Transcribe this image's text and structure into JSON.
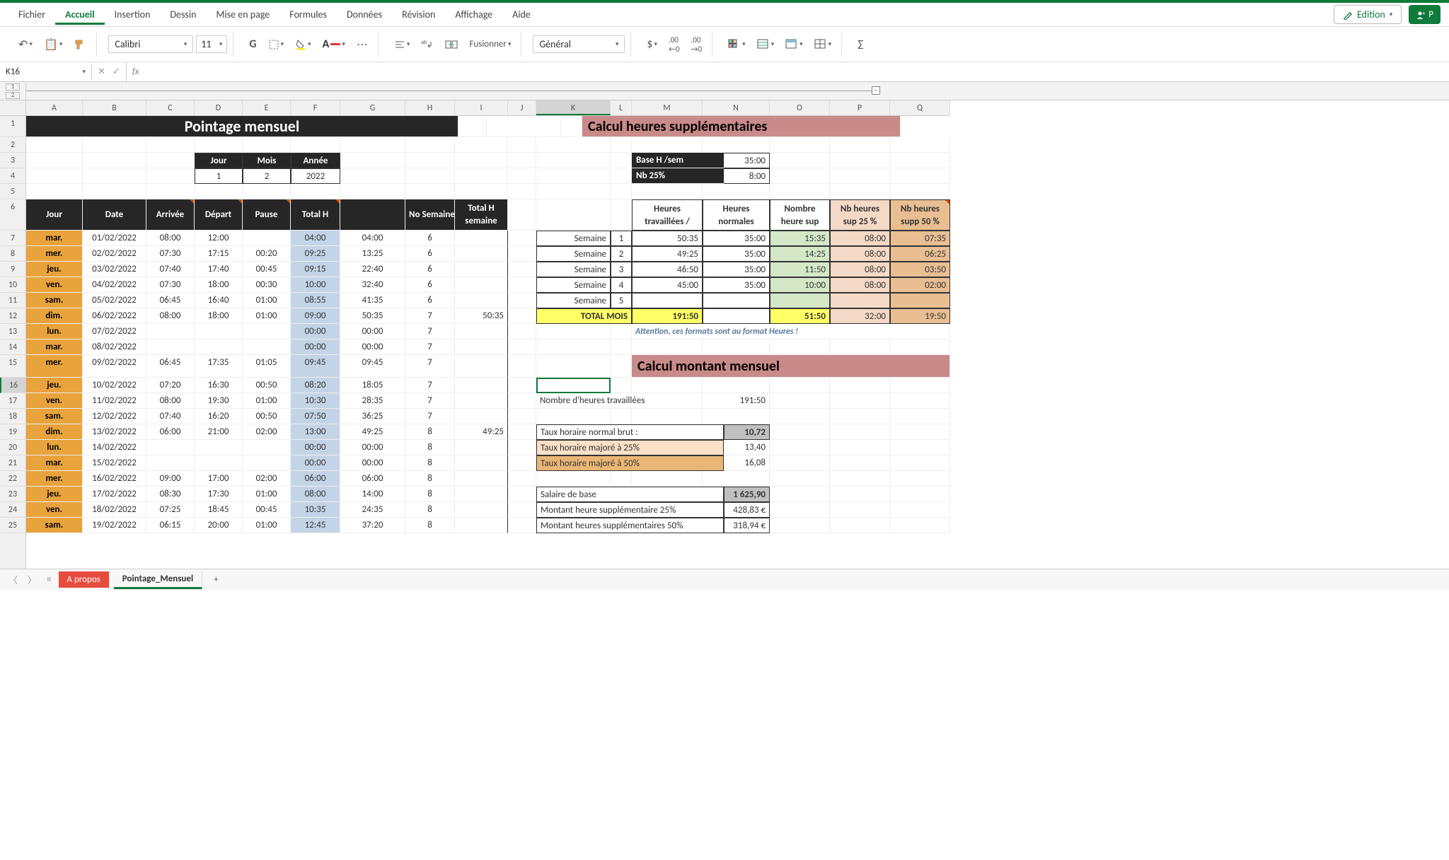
{
  "menu": {
    "items": [
      "Fichier",
      "Accueil",
      "Insertion",
      "Dessin",
      "Mise en page",
      "Formules",
      "Données",
      "Révision",
      "Affichage",
      "Aide"
    ],
    "active": 1,
    "edition": "Edition",
    "share": "P"
  },
  "ribbon": {
    "font": "Calibri",
    "size": "11",
    "format": "Général",
    "merge": "Fusionner"
  },
  "namebox": "K16",
  "cols": [
    "A",
    "B",
    "C",
    "D",
    "E",
    "F",
    "G",
    "H",
    "I",
    "J",
    "K",
    "L",
    "M",
    "N",
    "O",
    "P",
    "Q"
  ],
  "title": "Pointage mensuel",
  "dateHdr": {
    "j": "Jour",
    "m": "Mois",
    "a": "Année",
    "jv": "1",
    "mv": "2",
    "av": "2022"
  },
  "mainHdr": {
    "jour": "Jour",
    "date": "Date",
    "arr": "Arrivée",
    "dep": "Départ",
    "pause": "Pause",
    "tot": "Total H",
    "sem": "No Semaine",
    "totsem": "Total H\nsemaine"
  },
  "rows": [
    [
      "mar.",
      "01/02/2022",
      "08:00",
      "12:00",
      "",
      "04:00",
      "04:00",
      "6",
      ""
    ],
    [
      "mer.",
      "02/02/2022",
      "07:30",
      "17:15",
      "00:20",
      "09:25",
      "13:25",
      "6",
      ""
    ],
    [
      "jeu.",
      "03/02/2022",
      "07:40",
      "17:40",
      "00:45",
      "09:15",
      "22:40",
      "6",
      ""
    ],
    [
      "ven.",
      "04/02/2022",
      "07:30",
      "18:00",
      "00:30",
      "10:00",
      "32:40",
      "6",
      ""
    ],
    [
      "sam.",
      "05/02/2022",
      "06:45",
      "16:40",
      "01:00",
      "08:55",
      "41:35",
      "6",
      ""
    ],
    [
      "dim.",
      "06/02/2022",
      "08:00",
      "18:00",
      "01:00",
      "09:00",
      "50:35",
      "7",
      "50:35"
    ],
    [
      "lun.",
      "07/02/2022",
      "",
      "",
      "",
      "00:00",
      "00:00",
      "7",
      ""
    ],
    [
      "mar.",
      "08/02/2022",
      "",
      "",
      "",
      "00:00",
      "00:00",
      "7",
      ""
    ],
    [
      "mer.",
      "09/02/2022",
      "06:45",
      "17:35",
      "01:05",
      "09:45",
      "09:45",
      "7",
      ""
    ],
    [
      "jeu.",
      "10/02/2022",
      "07:20",
      "16:30",
      "00:50",
      "08:20",
      "18:05",
      "7",
      ""
    ],
    [
      "ven.",
      "11/02/2022",
      "08:00",
      "19:30",
      "01:00",
      "10:30",
      "28:35",
      "7",
      ""
    ],
    [
      "sam.",
      "12/02/2022",
      "07:40",
      "16:20",
      "00:50",
      "07:50",
      "36:25",
      "7",
      ""
    ],
    [
      "dim.",
      "13/02/2022",
      "06:00",
      "21:00",
      "02:00",
      "13:00",
      "49:25",
      "8",
      "49:25"
    ],
    [
      "lun.",
      "14/02/2022",
      "",
      "",
      "",
      "00:00",
      "00:00",
      "8",
      ""
    ],
    [
      "mar.",
      "15/02/2022",
      "",
      "",
      "",
      "00:00",
      "00:00",
      "8",
      ""
    ],
    [
      "mer.",
      "16/02/2022",
      "09:00",
      "17:00",
      "02:00",
      "06:00",
      "06:00",
      "8",
      ""
    ],
    [
      "jeu.",
      "17/02/2022",
      "08:30",
      "17:30",
      "01:00",
      "08:00",
      "14:00",
      "8",
      ""
    ],
    [
      "ven.",
      "18/02/2022",
      "07:25",
      "18:45",
      "00:45",
      "10:35",
      "24:35",
      "8",
      ""
    ],
    [
      "sam.",
      "19/02/2022",
      "06:15",
      "20:00",
      "01:00",
      "12:45",
      "37:20",
      "8",
      ""
    ]
  ],
  "supTitle": "Calcul heures supplémentaires",
  "base": {
    "l1": "Base H /sem",
    "v1": "35:00",
    "l2": "Nb 25%",
    "v2": "8:00"
  },
  "supHdr": [
    "Heures travaillées / semaine",
    "Heures normales",
    "Nombre heure sup",
    "Nb heures sup 25 %",
    "Nb heures supp 50 %"
  ],
  "weeks": [
    [
      "Semaine",
      "1",
      "50:35",
      "35:00",
      "15:35",
      "08:00",
      "07:35"
    ],
    [
      "Semaine",
      "2",
      "49:25",
      "35:00",
      "14:25",
      "08:00",
      "06:25"
    ],
    [
      "Semaine",
      "3",
      "46:50",
      "35:00",
      "11:50",
      "08:00",
      "03:50"
    ],
    [
      "Semaine",
      "4",
      "45:00",
      "35:00",
      "10:00",
      "08:00",
      "02:00"
    ],
    [
      "Semaine",
      "5",
      "",
      "",
      "",
      "",
      ""
    ]
  ],
  "totalRow": [
    "TOTAL MOIS",
    "191:50",
    "",
    "51:50",
    "32:00",
    "19:50"
  ],
  "note": "Attention, ces formats sont au format Heures !",
  "montTitle": "Calcul montant mensuel",
  "nbH": {
    "l": "Nombre d'heures travaillées",
    "v": "191:50"
  },
  "taux": [
    [
      "Taux horaire normal brut :",
      "10,72"
    ],
    [
      "Taux horaire majoré à 25%",
      "13,40"
    ],
    [
      "Taux horaire majoré à 50%",
      "16,08"
    ]
  ],
  "sal": [
    [
      "Salaire de base",
      "1 625,90"
    ],
    [
      "Montant heure supplémentaire 25%",
      "428,83 €"
    ],
    [
      "Montant heures supplémentaires 50%",
      "318,94 €"
    ]
  ],
  "tabs": {
    "t1": "A propos",
    "t2": "Pointage_Mensuel"
  }
}
